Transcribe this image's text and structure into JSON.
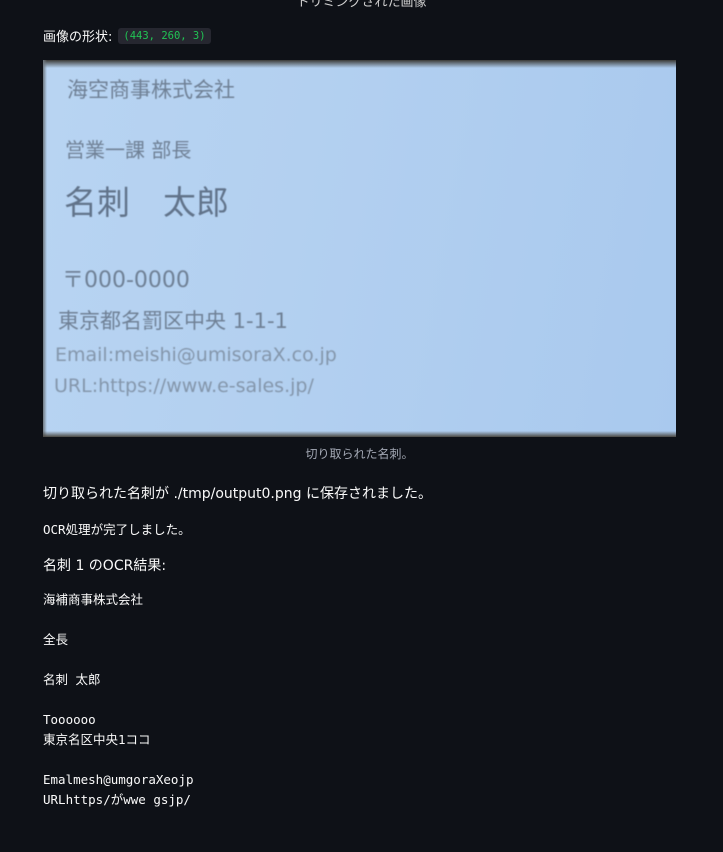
{
  "header": {
    "clipped_title": "トリミングされた画像"
  },
  "shape": {
    "label": "画像の形状:",
    "value": "(443, 260, 3)"
  },
  "card": {
    "company": "海空商事株式会社",
    "department": "営業一課 部長",
    "name": "名刺　太郎",
    "postal": "〒000-0000",
    "address": "東京都名罰区中央 1-1-1",
    "email": "Email:meishi@umisoraX.co.jp",
    "url": "URL:https://www.e-sales.jp/"
  },
  "caption": "切り取られた名刺。",
  "saved_message": "切り取られた名刺が ./tmp/output0.png に保存されました。",
  "ocr_done": "OCR処理が完了しました。",
  "ocr_heading": "名刺 1 のOCR結果:",
  "ocr_result": "海補商事株式会社\n\n全長\n\n名刺 太郎\n\nToooooo\n東京名区中央1ココ\n\nEmalmesh@umgoraXeojp\nURLhttps/がwwe gsjp/"
}
